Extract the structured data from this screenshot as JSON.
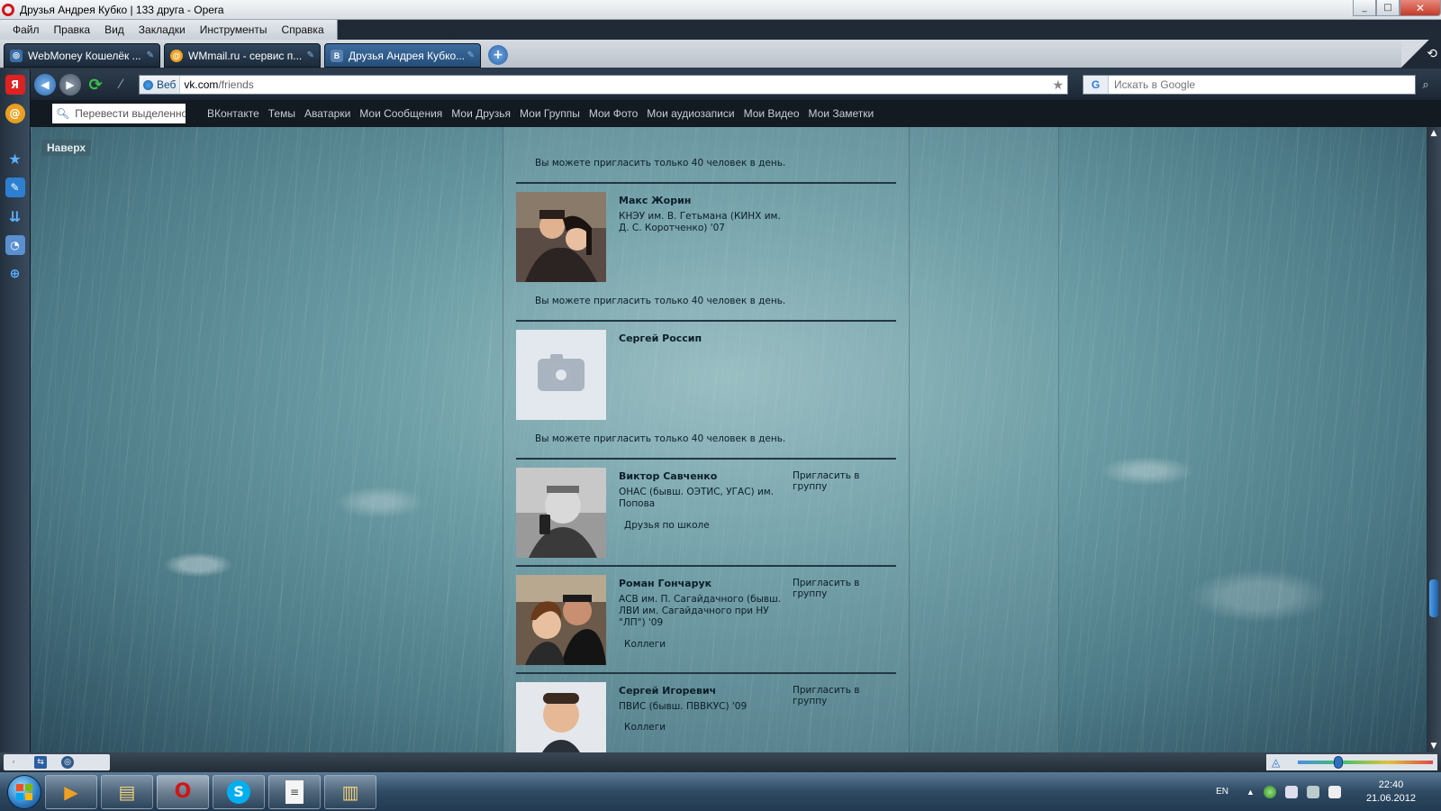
{
  "window": {
    "title": "Друзья Андрея Кубко | 133 друга - Opera",
    "controls": [
      "_",
      "□",
      "✕"
    ]
  },
  "menu": [
    "Файл",
    "Правка",
    "Вид",
    "Закладки",
    "Инструменты",
    "Справка"
  ],
  "tabs": [
    {
      "title": "WebMoney Кошелёк ...",
      "icon": "webmoney-icon",
      "active": false
    },
    {
      "title": "WMmail.ru - сервис п...",
      "icon": "wmmail-icon",
      "active": false
    },
    {
      "title": "Друзья Андрея Кубко...",
      "icon": "vk-icon",
      "active": true
    }
  ],
  "address": {
    "badge": "Веб",
    "host": "vk.com",
    "path": "/friends"
  },
  "search": {
    "placeholder": "Искать в Google",
    "engine_icon": "google-icon"
  },
  "personal_bar": {
    "translate_placeholder": "Перевести выделенное",
    "bookmarks": [
      "ВКонтакте",
      "Темы",
      "Аватарки",
      "Мои Сообщения",
      "Мои Друзья",
      "Мои Группы",
      "Мои Фото",
      "Мои аудиозаписи",
      "Мои Видео",
      "Мои Заметки"
    ]
  },
  "page": {
    "top_link": "Наверх",
    "invite_limit_note": "Вы можете пригласить только 40 человек в день.",
    "invite_to_group": "Пригласить в группу",
    "friends": [
      {
        "name": "Макс Жорин",
        "education": "КНЭУ им. В. Гетьмана (КИНХ им. Д. С. Коротченко) '07",
        "group": "",
        "has_invite": false,
        "has_photo": true
      },
      {
        "name": "Сергей Россип",
        "education": "",
        "group": "",
        "has_invite": false,
        "has_photo": false
      },
      {
        "name": "Виктор Савченко",
        "education": "ОНАС (бывш. ОЭТИС, УГАС) им. Попова",
        "group": "Друзья по школе",
        "has_invite": true,
        "has_photo": true
      },
      {
        "name": "Роман Гончарук",
        "education": "АСВ им. П. Сагайдачного (бывш. ЛВИ им. Сагайдачного при НУ \"ЛП\") '09",
        "group": "Коллеги",
        "has_invite": true,
        "has_photo": true
      },
      {
        "name": "Сергей Игоревич",
        "education": "ПВИС (бывш. ПВВКУС) '09",
        "group": "Коллеги",
        "has_invite": true,
        "has_photo": true
      }
    ]
  },
  "taskbar": {
    "apps": [
      "media-player-icon",
      "explorer-folder-icon",
      "opera-icon",
      "skype-icon",
      "notepad-icon",
      "folder-icon"
    ],
    "lang": "EN",
    "time": "22:40",
    "date": "21.06.2012"
  },
  "colors": {
    "chrome_dark": "#1f2a36",
    "tab_active": "#3c6d9f",
    "content_teal": "#6d9ea6",
    "text_dark": "#0b1e28"
  }
}
